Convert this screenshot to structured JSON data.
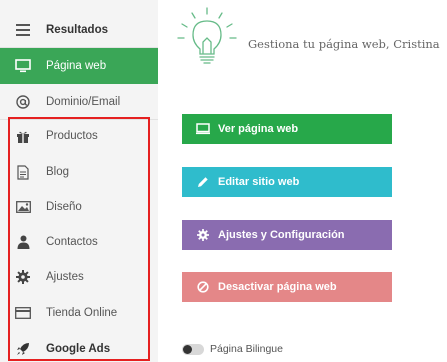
{
  "sidebar": {
    "items": [
      {
        "label": "Resultados",
        "icon": "hamburger-icon"
      },
      {
        "label": "Página web",
        "icon": "monitor-icon",
        "active": true
      },
      {
        "label": "Dominio/Email",
        "icon": "at-icon"
      },
      {
        "label": "Productos",
        "icon": "gift-icon"
      },
      {
        "label": "Blog",
        "icon": "document-icon"
      },
      {
        "label": "Diseño",
        "icon": "image-icon"
      },
      {
        "label": "Contactos",
        "icon": "person-icon"
      },
      {
        "label": "Ajustes",
        "icon": "gear-icon"
      },
      {
        "label": "Tienda Online",
        "icon": "card-icon"
      },
      {
        "label": "Google Ads",
        "icon": "rocket-icon"
      }
    ],
    "active_color": "#3aa657",
    "highlight_color": "#e52020"
  },
  "main": {
    "greeting": "Gestiona tu página web, Cristina",
    "buttons": [
      {
        "label": "Ver página web",
        "icon": "monitor-icon",
        "color": "#27a84a"
      },
      {
        "label": "Editar sitio web",
        "icon": "pencil-icon",
        "color": "#2fbccc"
      },
      {
        "label": "Ajustes y Configuración",
        "icon": "gear-icon",
        "color": "#8a6cb0"
      },
      {
        "label": "Desactivar página web",
        "icon": "ban-icon",
        "color": "#e48788"
      }
    ],
    "toggle": {
      "label": "Página Bilingue",
      "on": false
    }
  }
}
